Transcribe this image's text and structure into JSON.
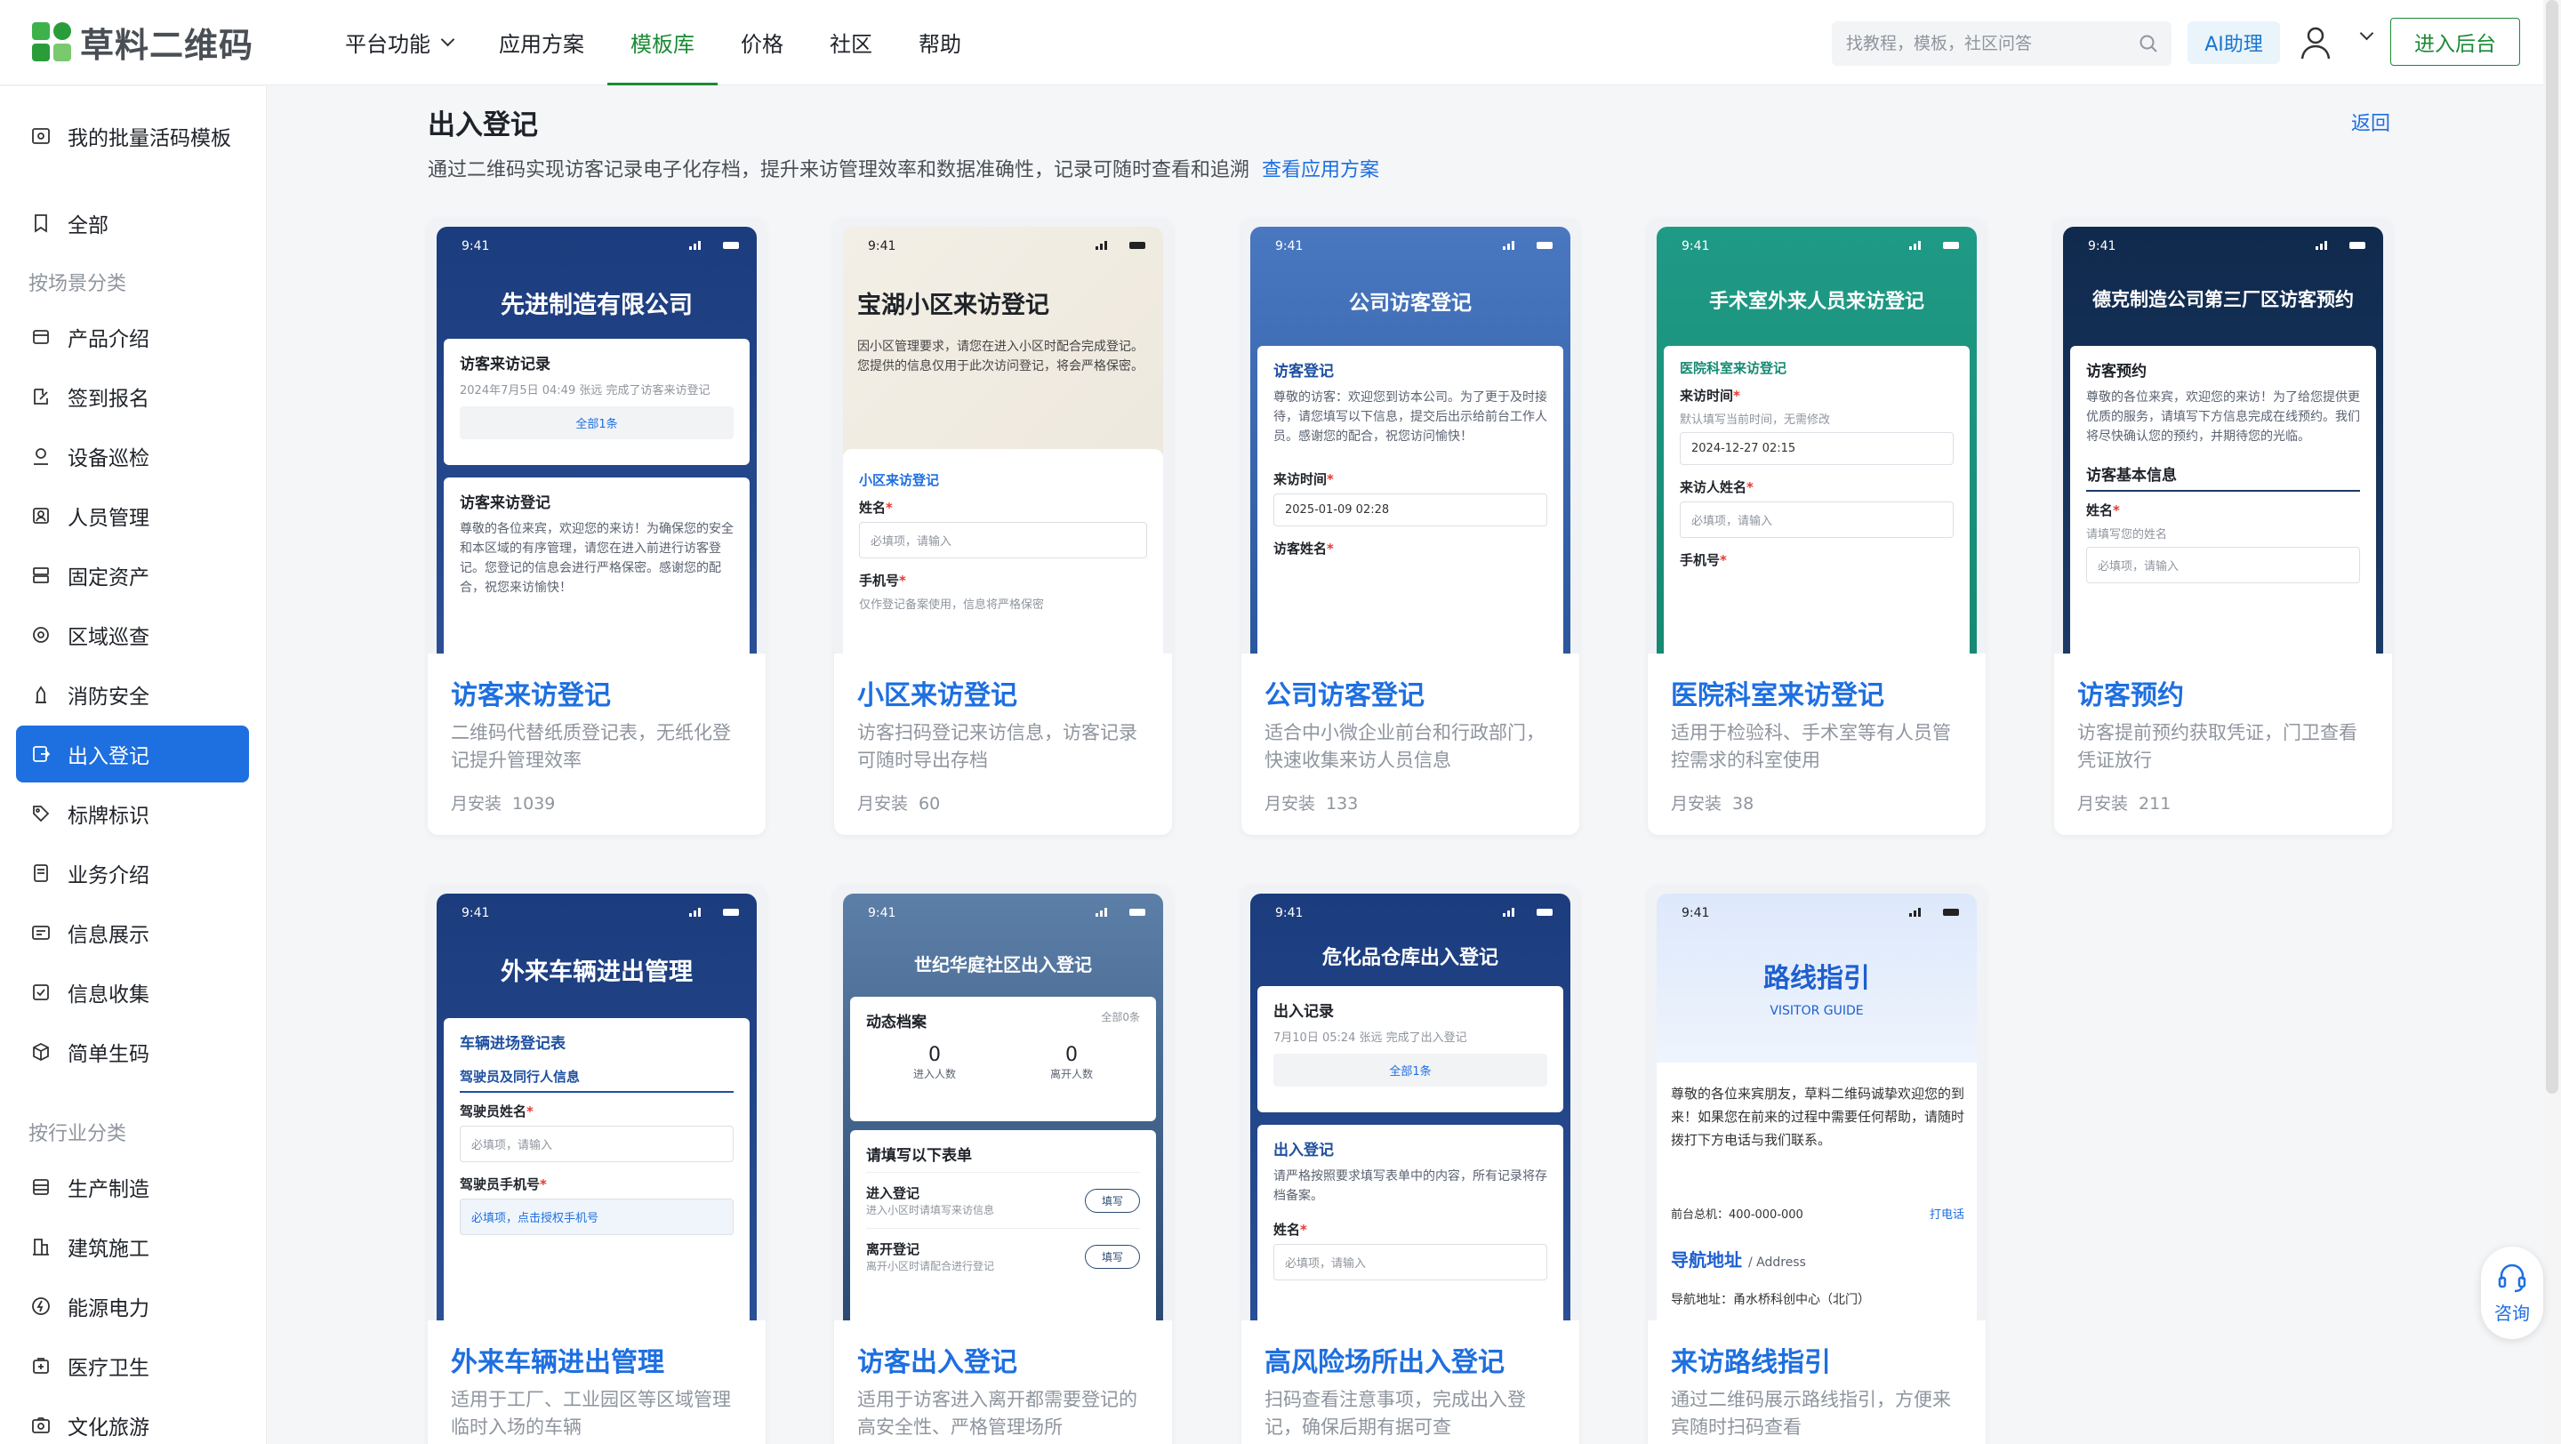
{
  "brand": {
    "name": "草料二维码"
  },
  "nav": {
    "items": [
      "平台功能",
      "应用方案",
      "模板库",
      "价格",
      "社区",
      "帮助"
    ],
    "active": 2
  },
  "search": {
    "placeholder": "找教程，模板，社区问答"
  },
  "header": {
    "ai_label": "AI助理",
    "enter_label": "进入后台"
  },
  "sidebar": {
    "batch": "我的批量活码模板",
    "all": "全部",
    "group_scene": "按场景分类",
    "scene_items": [
      "产品介绍",
      "签到报名",
      "设备巡检",
      "人员管理",
      "固定资产",
      "区域巡查",
      "消防安全",
      "出入登记",
      "标牌标识",
      "业务介绍",
      "信息展示",
      "信息收集",
      "简单生码"
    ],
    "active_index": 7,
    "group_industry": "按行业分类",
    "industry_items": [
      "生产制造",
      "建筑施工",
      "能源电力",
      "医疗卫生",
      "文化旅游"
    ]
  },
  "page": {
    "title": "出入登记",
    "desc": "通过二维码实现访客记录电子化存档，提升来访管理效率和数据准确性，记录可随时查看和追溯",
    "link": "查看应用方案",
    "back": "返回",
    "monthly_label": "月安装"
  },
  "cards": [
    {
      "title": "访客来访登记",
      "desc": "二维码代替纸质登记表，无纸化登记提升管理效率",
      "installs": "1039",
      "shot": {
        "time": "9:41",
        "header": "先进制造有限公司",
        "c1_title": "访客来访记录",
        "c1_line": "2024年7月5日 04:49  张远 完成了访客来访登记",
        "c1_btn": "全部1条",
        "c2_title": "访客来访登记",
        "c2_text": "尊敬的各位来宾，欢迎您的来访！为确保您的安全和本区域的有序管理，请您在进入前进行访客登记。您登记的信息会进行严格保密。感谢您的配合，祝您来访愉快！"
      }
    },
    {
      "title": "小区来访登记",
      "desc": "访客扫码登记来访信息，访客记录可随时导出存档",
      "installs": "60",
      "shot": {
        "time": "9:41",
        "header": "宝湖小区来访登记",
        "intro": "因小区管理要求，请您在进入小区时配合完成登记。您提供的信息仅用于此次访问登记，将会严格保密。",
        "sub": "小区来访登记",
        "label1": "姓名",
        "ph1": "必填项，请输入",
        "label2": "手机号",
        "hint2": "仅作登记备案使用，信息将严格保密"
      }
    },
    {
      "title": "公司访客登记",
      "desc": "适合中小微企业前台和行政部门，快速收集来访人员信息",
      "installs": "133",
      "shot": {
        "time": "9:41",
        "header": "公司访客登记",
        "c_title": "访客登记",
        "c_text": "尊敬的访客：欢迎您到访本公司。为了更于及时接待，请您填写以下信息，提交后出示给前台工作人员。感谢您的配合，祝您访问愉快！",
        "label1": "来访时间",
        "val1": "2025-01-09 02:28",
        "label2": "访客姓名"
      }
    },
    {
      "title": "医院科室来访登记",
      "desc": "适用于检验科、手术室等有人员管控需求的科室使用",
      "installs": "38",
      "shot": {
        "time": "9:41",
        "header": "手术室外来人员来访登记",
        "sub": "医院科室来访登记",
        "label1": "来访时间",
        "hint1": "默认填写当前时间，无需修改",
        "val1": "2024-12-27 02:15",
        "label2": "来访人姓名",
        "ph2": "必填项，请输入",
        "label3": "手机号"
      }
    },
    {
      "title": "访客预约",
      "desc": "访客提前预约获取凭证，门卫查看凭证放行",
      "installs": "211",
      "shot": {
        "time": "9:41",
        "header": "德克制造公司第三厂区访客预约",
        "c_title": "访客预约",
        "c_text": "尊敬的各位来宾，欢迎您的来访！为了给您提供更优质的服务，请填写下方信息完成在线预约。我们将尽快确认您的预约，并期待您的光临。",
        "sub": "访客基本信息",
        "label1": "姓名",
        "hint1": "请填写您的姓名",
        "ph1": "必填项，请输入"
      }
    },
    {
      "title": "外来车辆进出管理",
      "desc": "适用于工厂、工业园区等区域管理临时入场的车辆",
      "installs": "",
      "shot": {
        "time": "9:41",
        "header": "外来车辆进出管理",
        "c_title": "车辆进场登记表",
        "sub": "驾驶员及同行人信息",
        "label1": "驾驶员姓名",
        "ph1": "必填项，请输入",
        "label2": "驾驶员手机号",
        "ph2": "必填项，点击授权手机号"
      }
    },
    {
      "title": "访客出入登记",
      "desc": "适用于访客进入离开都需要登记的高安全性、严格管理场所",
      "installs": "",
      "shot": {
        "time": "9:41",
        "header": "世纪华庭社区出入登记",
        "c1_title": "动态档案",
        "c1_more": "全部0条",
        "in_num": "0",
        "in_label": "进入人数",
        "out_num": "0",
        "out_label": "离开人数",
        "c2_title": "请填写以下表单",
        "r1_title": "进入登记",
        "r1_sub": "进入小区时请填写来访信息",
        "r2_title": "离开登记",
        "r2_sub": "离开小区时请配合进行登记",
        "btn": "填写"
      }
    },
    {
      "title": "高风险场所出入登记",
      "desc": "扫码查看注意事项，完成出入登记，确保后期有据可查",
      "installs": "",
      "shot": {
        "time": "9:41",
        "header": "危化品仓库出入登记",
        "c1_title": "出入记录",
        "c1_line": "7月10日 05:24  张远 完成了出入登记",
        "c1_btn": "全部1条",
        "c2_title": "出入登记",
        "c2_text": "请严格按照要求填写表单中的内容，所有记录将存档备案。",
        "label1": "姓名",
        "ph1": "必填项，请输入"
      }
    },
    {
      "title": "来访路线指引",
      "desc": "通过二维码展示路线指引，方便来宾随时扫码查看",
      "installs": "",
      "shot": {
        "time": "9:41",
        "header": "路线指引",
        "header_en": "VISITOR GUIDE",
        "text": "尊敬的各位来宾朋友，草料二维码诚挚欢迎您的到来！如果您在前来的过程中需要任何帮助，请随时拨打下方电话与我们联系。",
        "phone": "前台总机：400-000-000",
        "call": "打电话",
        "nav_title": "导航地址",
        "nav_en": "/ Address",
        "addr": "导航地址：甬水桥科创中心（北门）"
      }
    }
  ],
  "consult": {
    "label": "咨询"
  },
  "colors": {
    "primary": "#1e6fe0",
    "brand_green": "#1a8a35",
    "active_bg": "#1e6fe0"
  }
}
